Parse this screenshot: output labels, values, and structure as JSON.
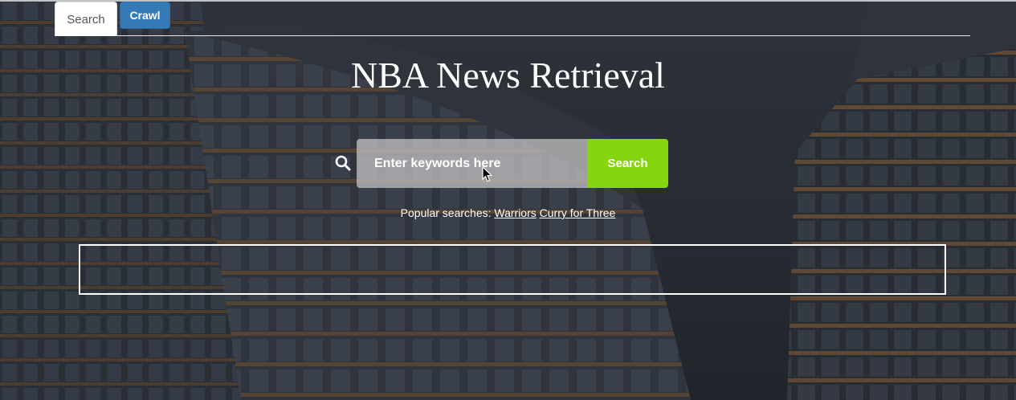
{
  "tabs": {
    "search_label": "Search",
    "crawl_label": "Crawl"
  },
  "header": {
    "title": "NBA News Retrieval"
  },
  "search": {
    "placeholder": "Enter keywords here",
    "button_label": "Search",
    "icon": "search-icon"
  },
  "popular": {
    "prefix": "Popular searches:",
    "links": [
      "Warriors",
      "Curry for Three"
    ]
  },
  "colors": {
    "accent_green": "#86d60f",
    "tab_blue": "#337ab7"
  }
}
